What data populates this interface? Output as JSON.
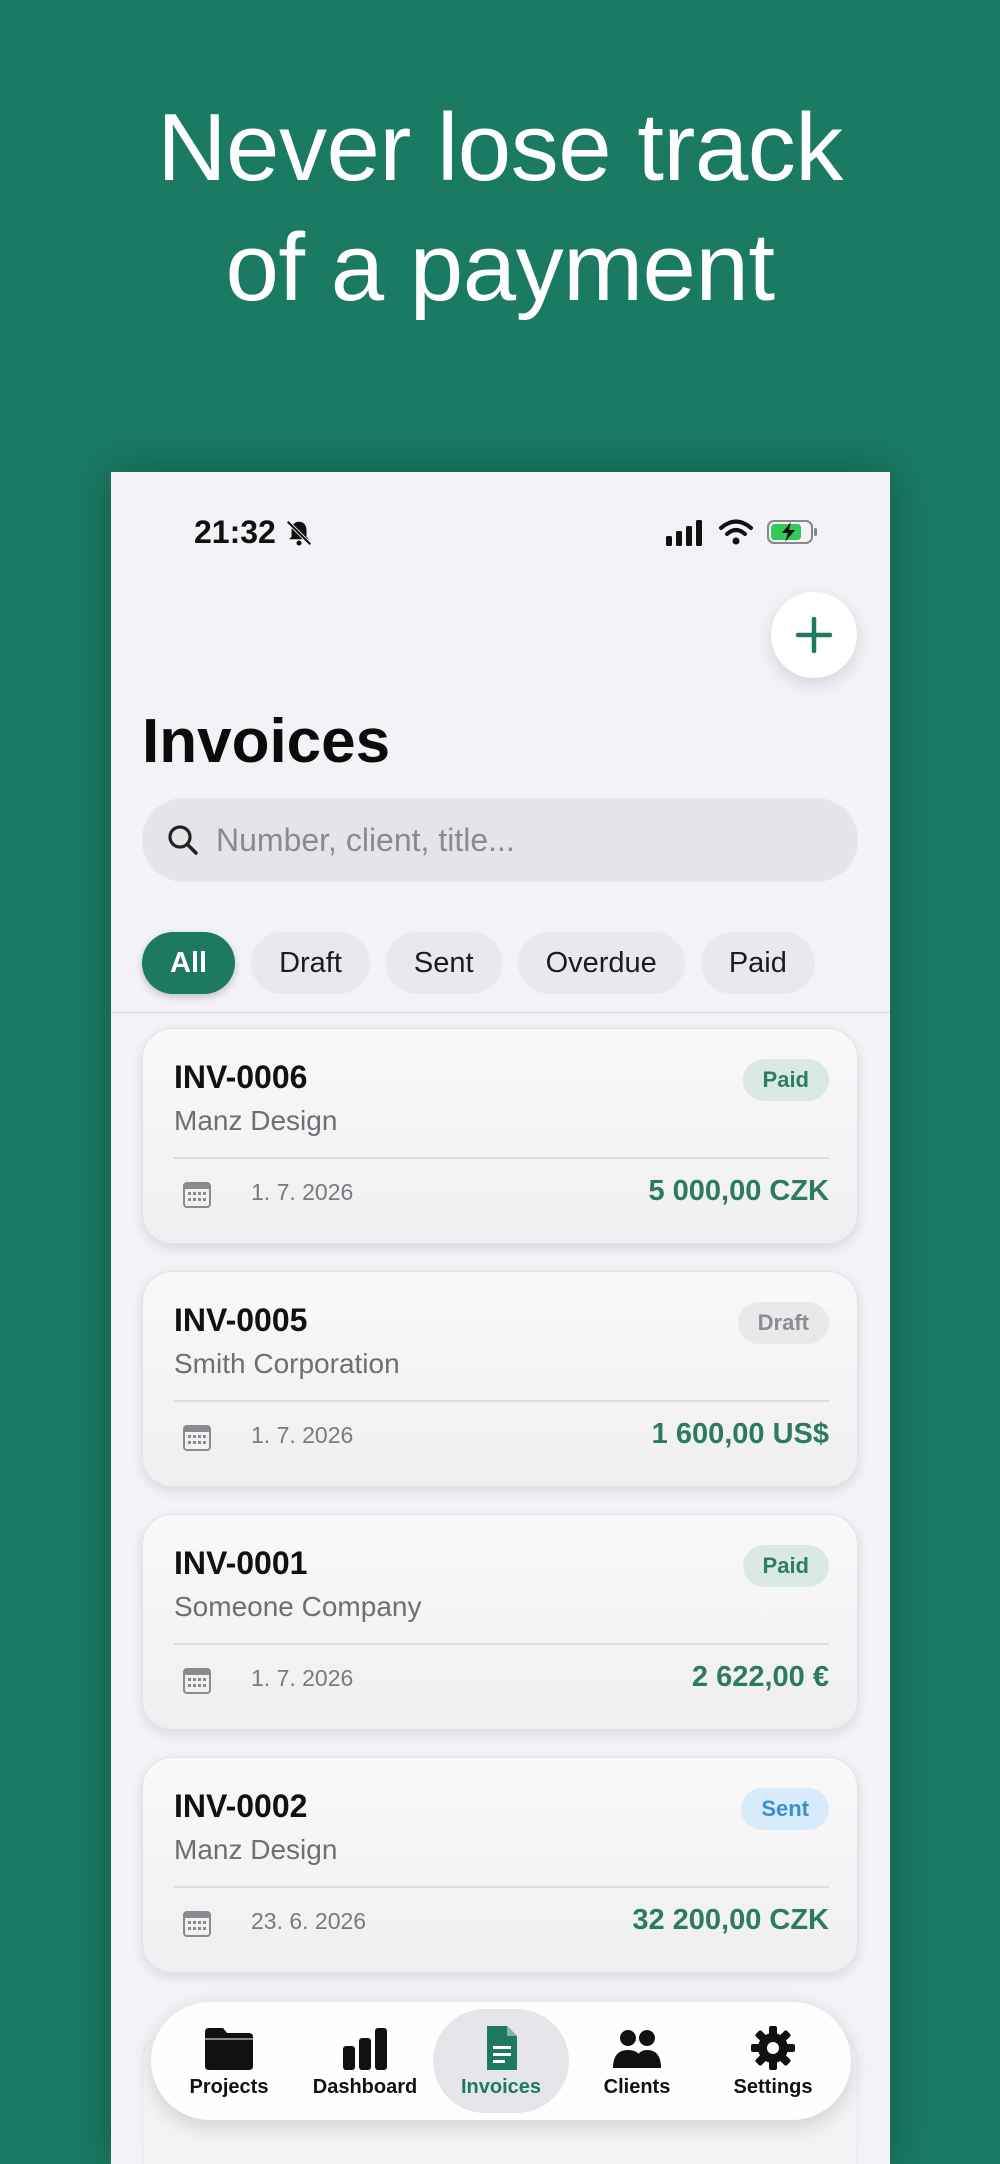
{
  "headline": {
    "line1": "Never lose track",
    "line2": "of a payment"
  },
  "status_bar": {
    "time": "21:32"
  },
  "header": {
    "title": "Invoices",
    "add_icon": "plus-icon"
  },
  "search": {
    "placeholder": "Number, client, title..."
  },
  "filters": [
    {
      "label": "All",
      "active": true
    },
    {
      "label": "Draft",
      "active": false
    },
    {
      "label": "Sent",
      "active": false
    },
    {
      "label": "Overdue",
      "active": false
    },
    {
      "label": "Paid",
      "active": false
    }
  ],
  "invoices": [
    {
      "number": "INV-0006",
      "client": "Manz Design",
      "status": "Paid",
      "date": "1. 7. 2026",
      "amount": "5 000,00 CZK"
    },
    {
      "number": "INV-0005",
      "client": "Smith Corporation",
      "status": "Draft",
      "date": "1. 7. 2026",
      "amount": "1 600,00 US$"
    },
    {
      "number": "INV-0001",
      "client": "Someone Company",
      "status": "Paid",
      "date": "1. 7. 2026",
      "amount": "2 622,00 €"
    },
    {
      "number": "INV-0002",
      "client": "Manz Design",
      "status": "Sent",
      "date": "23. 6. 2026",
      "amount": "32 200,00 CZK"
    }
  ],
  "tab_bar": {
    "items": [
      {
        "label": "Projects",
        "icon": "folder-icon",
        "active": false
      },
      {
        "label": "Dashboard",
        "icon": "bar-chart-icon",
        "active": false
      },
      {
        "label": "Invoices",
        "icon": "document-icon",
        "active": true
      },
      {
        "label": "Clients",
        "icon": "people-icon",
        "active": false
      },
      {
        "label": "Settings",
        "icon": "gear-icon",
        "active": false
      }
    ]
  },
  "colors": {
    "brand": "#1a7a62",
    "accent": "#1d7a60",
    "paid_badge": "#dbe9e3",
    "sent_badge": "#d7ebfa"
  }
}
